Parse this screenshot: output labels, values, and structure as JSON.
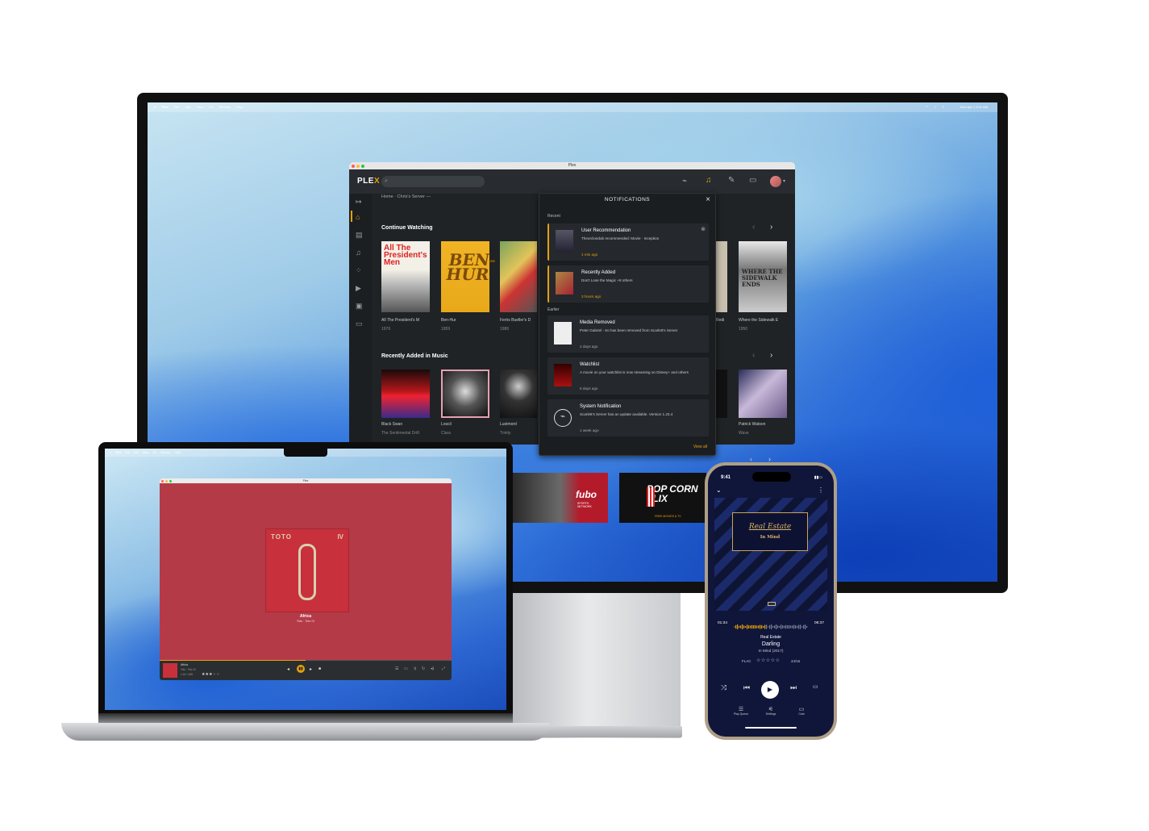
{
  "monitor": {
    "menubar": {
      "apple": "",
      "items": [
        "Plex",
        "File",
        "Edit",
        "View",
        "Go",
        "Window",
        "Help"
      ],
      "clock": "Wed Apr 1  9:41 AM"
    },
    "plex_window": {
      "window_title": "Plex",
      "logo": "PLE",
      "logo_x": "X",
      "breadcrumb": "Home · Chris's Server",
      "continue_watching": {
        "title": "Continue Watching",
        "items": [
          {
            "title": "All The President's M",
            "year": "1976"
          },
          {
            "title": "Ben-Hur",
            "year": "1959"
          },
          {
            "title": "Ferris Bueller's D",
            "year": "1986"
          },
          {
            "title": "Where the Sidewalk E",
            "year": "1950"
          }
        ],
        "partial_label": "Redi"
      },
      "recently_added_music": {
        "title": "Recently Added in Music",
        "items": [
          {
            "title": "Black Swan",
            "artist": "The Sentimental Drift"
          },
          {
            "title": "Loscil",
            "artist": "Clara"
          },
          {
            "title": "Lustmord",
            "artist": "Trinity"
          },
          {
            "title": "Patrick Watson",
            "artist": "Wave"
          }
        ]
      }
    },
    "notifications": {
      "header": "NOTIFICATIONS",
      "recent_label": "Recent",
      "earlier_label": "Earlier",
      "view_all": "View all",
      "recent": [
        {
          "title": "User Recommendation",
          "body": "Theorclondub recommended: Movie · Inception",
          "time": "1 min ago"
        },
        {
          "title": "Recently Added",
          "body": "Don't Lose the Magic +8 others",
          "time": "3 hours ago"
        }
      ],
      "earlier": [
        {
          "title": "Media Removed",
          "body": "Peter Gabriel - So has been removed from Scarlett's Server",
          "time": "2 days ago"
        },
        {
          "title": "Watchlist",
          "body": "A movie on your watchlist is now streaming on Disney+ and others",
          "time": "6 days ago"
        },
        {
          "title": "System Notification",
          "body": "Scarlett's Server has an update available. Version 1.23.4",
          "time": "1 week ago"
        }
      ]
    },
    "tiles": {
      "fubo": "fubo",
      "fubo_sub": "SPORTS NETWORK",
      "popcorn": "POP CORN FLIX",
      "popcorn_sub": "FREE MOVIES & TV"
    }
  },
  "laptop": {
    "menubar": [
      "Plex",
      "File",
      "Edit",
      "View",
      "Go",
      "Window",
      "Help"
    ],
    "window_title": "Plex",
    "album_text": "TOTO",
    "album_numeral": "IV",
    "track": "Africa",
    "subtitle": "Toto · Toto IV",
    "player": {
      "track": "Africa",
      "artist": "Toto · Toto IV",
      "time": "1:16 / 4:55",
      "progress": 0.5,
      "rating": 3
    }
  },
  "phone": {
    "time": "9:41",
    "artwork_title": "Real Estate",
    "artwork_subtitle": "In Mind",
    "elapsed": "01:34",
    "remaining": "06:37",
    "artist": "Real Estate",
    "track": "Darling",
    "album": "In Mind (2017)",
    "format": "FLAC",
    "track_number": "44/16",
    "tabs": [
      "Play Queue",
      "Settings",
      "Cast"
    ]
  },
  "colors": {
    "plex_gold": "#e5a00d",
    "plex_bg": "#1f2326",
    "laptop_album_red": "#c8303c",
    "phone_bg": "#10163a"
  }
}
